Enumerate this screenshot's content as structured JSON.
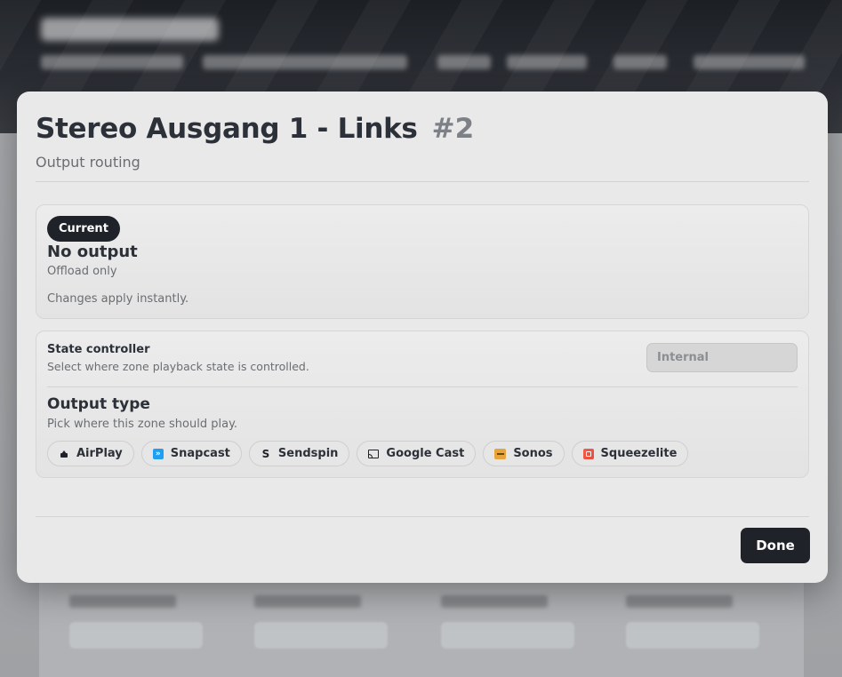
{
  "modal": {
    "title": "Stereo Ausgang 1 - Links",
    "title_number": "#2",
    "subtitle": "Output routing",
    "done_label": "Done"
  },
  "current": {
    "badge": "Current",
    "title": "No output",
    "subtitle": "Offload only",
    "note": "Changes apply instantly."
  },
  "state_controller": {
    "label": "State controller",
    "description": "Select where zone playback state is controlled.",
    "selected_value": "Internal"
  },
  "output_type": {
    "title": "Output type",
    "description": "Pick where this zone should play.",
    "options": [
      {
        "label": "AirPlay",
        "icon": "airplay-icon"
      },
      {
        "label": "Snapcast",
        "icon": "snapcast-icon"
      },
      {
        "label": "Sendspin",
        "icon": "sendspin-icon"
      },
      {
        "label": "Google Cast",
        "icon": "cast-icon"
      },
      {
        "label": "Sonos",
        "icon": "sonos-icon"
      },
      {
        "label": "Squeezelite",
        "icon": "squeezelite-icon"
      }
    ]
  },
  "colors": {
    "accent_dark": "#1f2329",
    "snapcast": "#1e9ff2",
    "sonos": "#e8a33a",
    "squeezelite": "#e64b3c"
  }
}
